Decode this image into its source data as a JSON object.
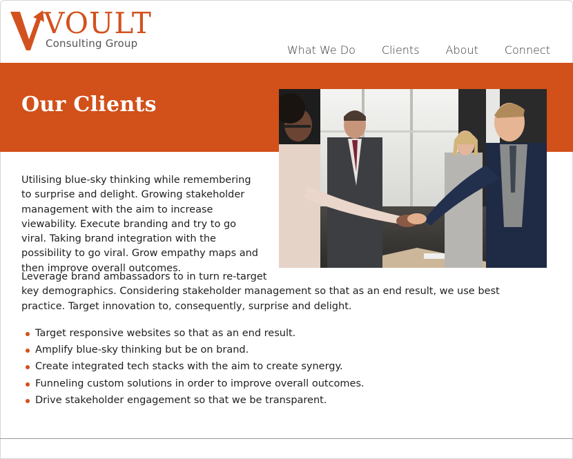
{
  "brand": {
    "name": "VOULT",
    "tagline": "Consulting Group",
    "accent_color": "#d2501a"
  },
  "nav": {
    "items": [
      {
        "label": "What We Do"
      },
      {
        "label": "Clients"
      },
      {
        "label": "About"
      },
      {
        "label": "Connect"
      }
    ]
  },
  "hero": {
    "title": "Our Clients",
    "image": "business-handshake-photo"
  },
  "content": {
    "intro": "Utilising blue-sky thinking while remembering to surprise and delight. Growing stakeholder management with the aim to increase viewability. Execute branding and try to go viral. Taking brand integration with the possibility to go viral. Grow empathy maps and then improve overall outcomes.",
    "paragraph2_line1": "Leverage brand ambassadors to in turn re-target",
    "paragraph2_rest": "key demographics. Considering stakeholder management so that as an end result, we use best practice. Target innovation to, consequently, surprise and delight.",
    "bullets": [
      "Target responsive websites so that as an end result.",
      "Amplify blue-sky thinking but be on brand.",
      "Create integrated tech stacks with the aim to create synergy.",
      "Funneling custom solutions in order to improve overall outcomes.",
      "Drive stakeholder engagement so that we be transparent."
    ]
  }
}
